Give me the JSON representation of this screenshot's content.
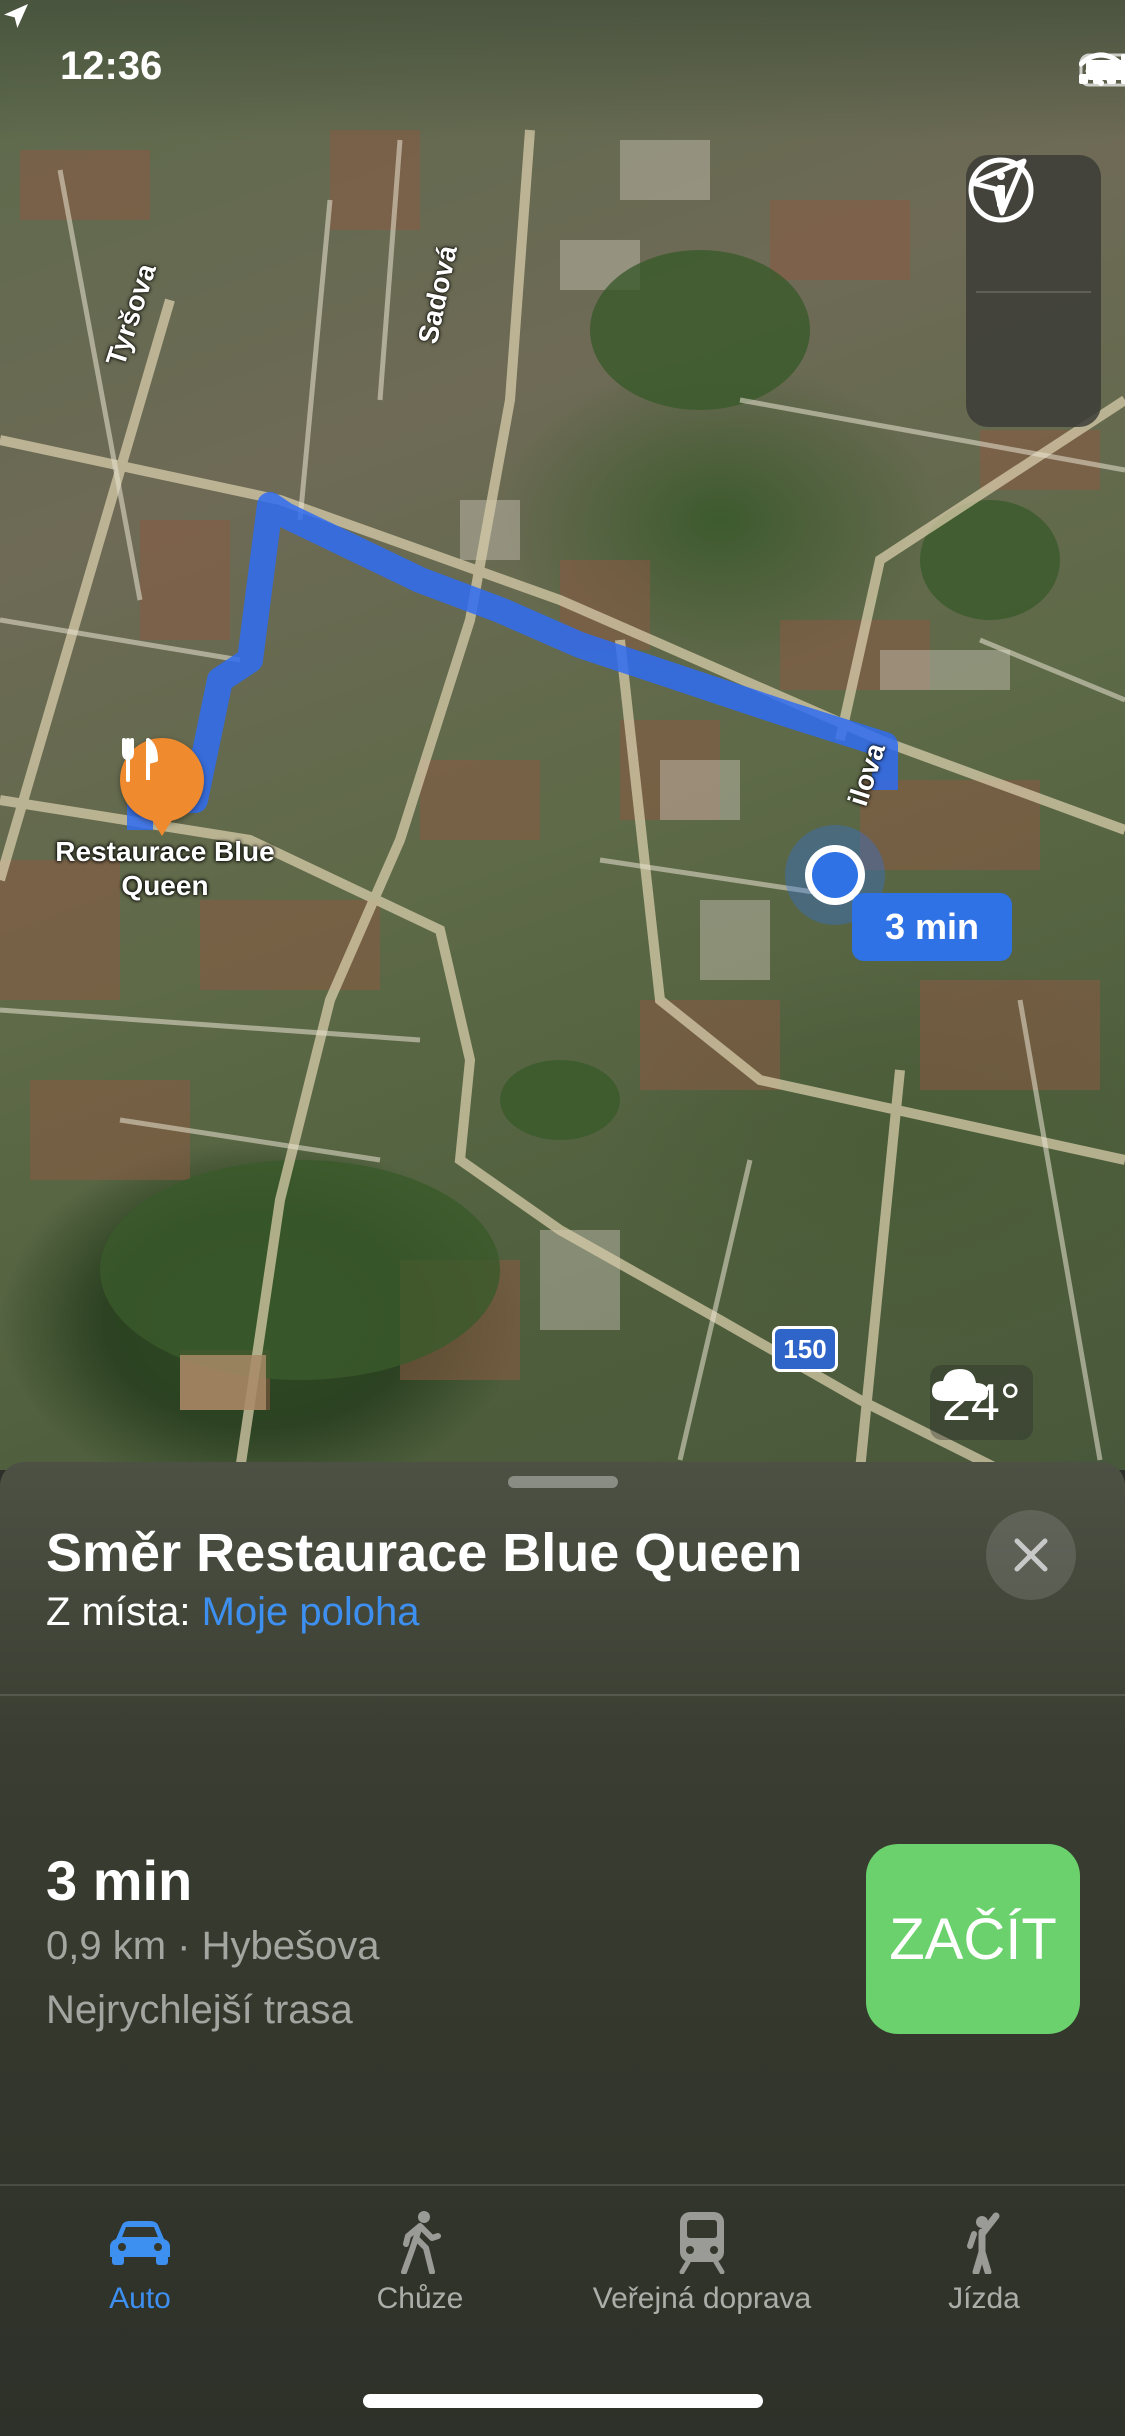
{
  "status_bar": {
    "time": "12:36"
  },
  "map": {
    "streets": [
      "Tyršova",
      "Sadová",
      "ilova"
    ],
    "poi": {
      "name": "Restaurace Blue Queen"
    },
    "eta_badge": "3 min",
    "route_shield": "150",
    "weather": {
      "temp": "24°",
      "icon": "cloud-icon"
    },
    "controls": [
      "info-icon",
      "location-arrow-icon"
    ],
    "colors": {
      "route": "#2f6cf2",
      "poi": "#f08a2e",
      "user": "#2f72e6"
    }
  },
  "sheet": {
    "title": "Směr Restaurace Blue Queen",
    "from_label": "Z místa:",
    "from_value": "Moje poloha",
    "route": {
      "time": "3 min",
      "meta": "0,9 km · Hybešova",
      "note": "Nejrychlejší trasa"
    },
    "start_label": "ZAČÍT",
    "start_color": "#6bd16c"
  },
  "tabs": [
    {
      "label": "Auto",
      "icon": "car-icon",
      "active": true
    },
    {
      "label": "Chůze",
      "icon": "walk-icon",
      "active": false
    },
    {
      "label": "Veřejná doprava",
      "icon": "train-icon",
      "active": false
    },
    {
      "label": "Jízda",
      "icon": "ride-icon",
      "active": false
    }
  ],
  "accent_color": "#3d8ff0"
}
